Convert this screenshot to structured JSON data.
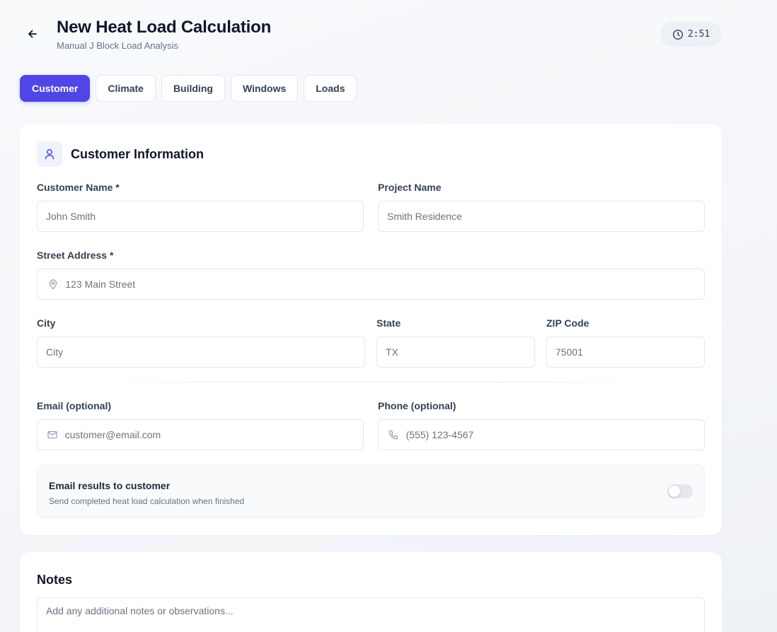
{
  "header": {
    "title": "New Heat Load Calculation",
    "subtitle": "Manual J Block Load Analysis",
    "timer": "2:51",
    "back_icon": "arrow-left-icon",
    "timer_icon": "clock-icon"
  },
  "tabs": [
    {
      "label": "Customer",
      "active": true
    },
    {
      "label": "Climate",
      "active": false
    },
    {
      "label": "Building",
      "active": false
    },
    {
      "label": "Windows",
      "active": false
    },
    {
      "label": "Loads",
      "active": false
    }
  ],
  "customer_section": {
    "title": "Customer Information",
    "icon": "user-icon",
    "fields": {
      "customer_name": {
        "label": "Customer Name *",
        "placeholder": "John Smith",
        "value": ""
      },
      "project_name": {
        "label": "Project Name",
        "placeholder": "Smith Residence",
        "value": ""
      },
      "street_address": {
        "label": "Street Address *",
        "placeholder": "123 Main Street",
        "value": "",
        "icon": "map-pin-icon"
      },
      "city": {
        "label": "City",
        "placeholder": "City",
        "value": ""
      },
      "state": {
        "label": "State",
        "placeholder": "TX",
        "value": ""
      },
      "zip": {
        "label": "ZIP Code",
        "placeholder": "75001",
        "value": ""
      },
      "email": {
        "label": "Email (optional)",
        "placeholder": "customer@email.com",
        "value": "",
        "icon": "mail-icon"
      },
      "phone": {
        "label": "Phone (optional)",
        "placeholder": "(555) 123-4567",
        "value": "",
        "icon": "phone-icon"
      }
    },
    "email_toggle": {
      "title": "Email results to customer",
      "description": "Send completed heat load calculation when finished",
      "enabled": false
    }
  },
  "notes": {
    "title": "Notes",
    "placeholder": "Add any additional notes or observations..."
  },
  "colors": {
    "accent": "#4f46e5",
    "accent_light": "#eef2ff",
    "text": "#0f172a",
    "muted": "#64748b",
    "border": "#e2e8f0"
  }
}
